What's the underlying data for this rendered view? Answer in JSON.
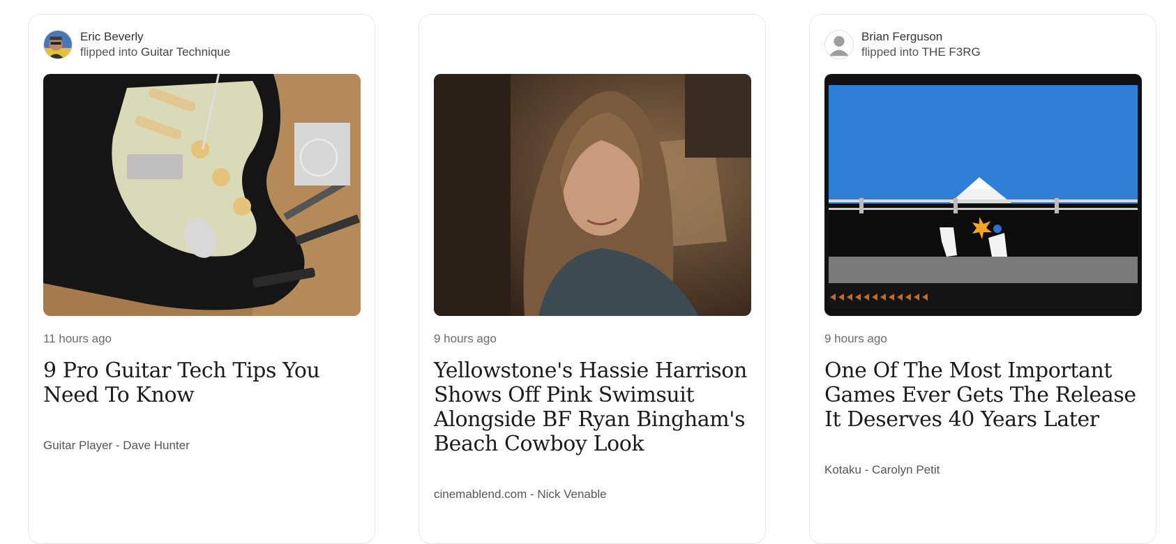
{
  "cards": [
    {
      "user": "Eric Beverly",
      "flipped_label": "flipped into",
      "magazine": "Guitar Technique",
      "time": "11 hours ago",
      "title": "9 Pro Guitar Tech Tips You Need To Know",
      "source": "Guitar Player - Dave Hunter",
      "image_icon": "guitar-photo"
    },
    {
      "user": "",
      "flipped_label": "",
      "magazine": "",
      "time": "9 hours ago",
      "title": "Yellowstone's Hassie Harrison Shows Off Pink Swimsuit Alongside BF Ryan Bingham's Beach Cowboy Look",
      "source": "cinemablend.com - Nick Venable",
      "image_icon": "portrait-photo"
    },
    {
      "user": "Brian Ferguson",
      "flipped_label": "flipped into",
      "magazine": "THE F3RG",
      "time": "9 hours ago",
      "title": "One Of The Most Important Games Ever Gets The Release It Deserves 40 Years Later",
      "source": "Kotaku - Carolyn Petit",
      "image_icon": "retro-game-screenshot"
    }
  ],
  "colors": {
    "card_border": "#e6e6e6",
    "meta_text": "#6b6b6b",
    "title_text": "#1b1b1b"
  }
}
